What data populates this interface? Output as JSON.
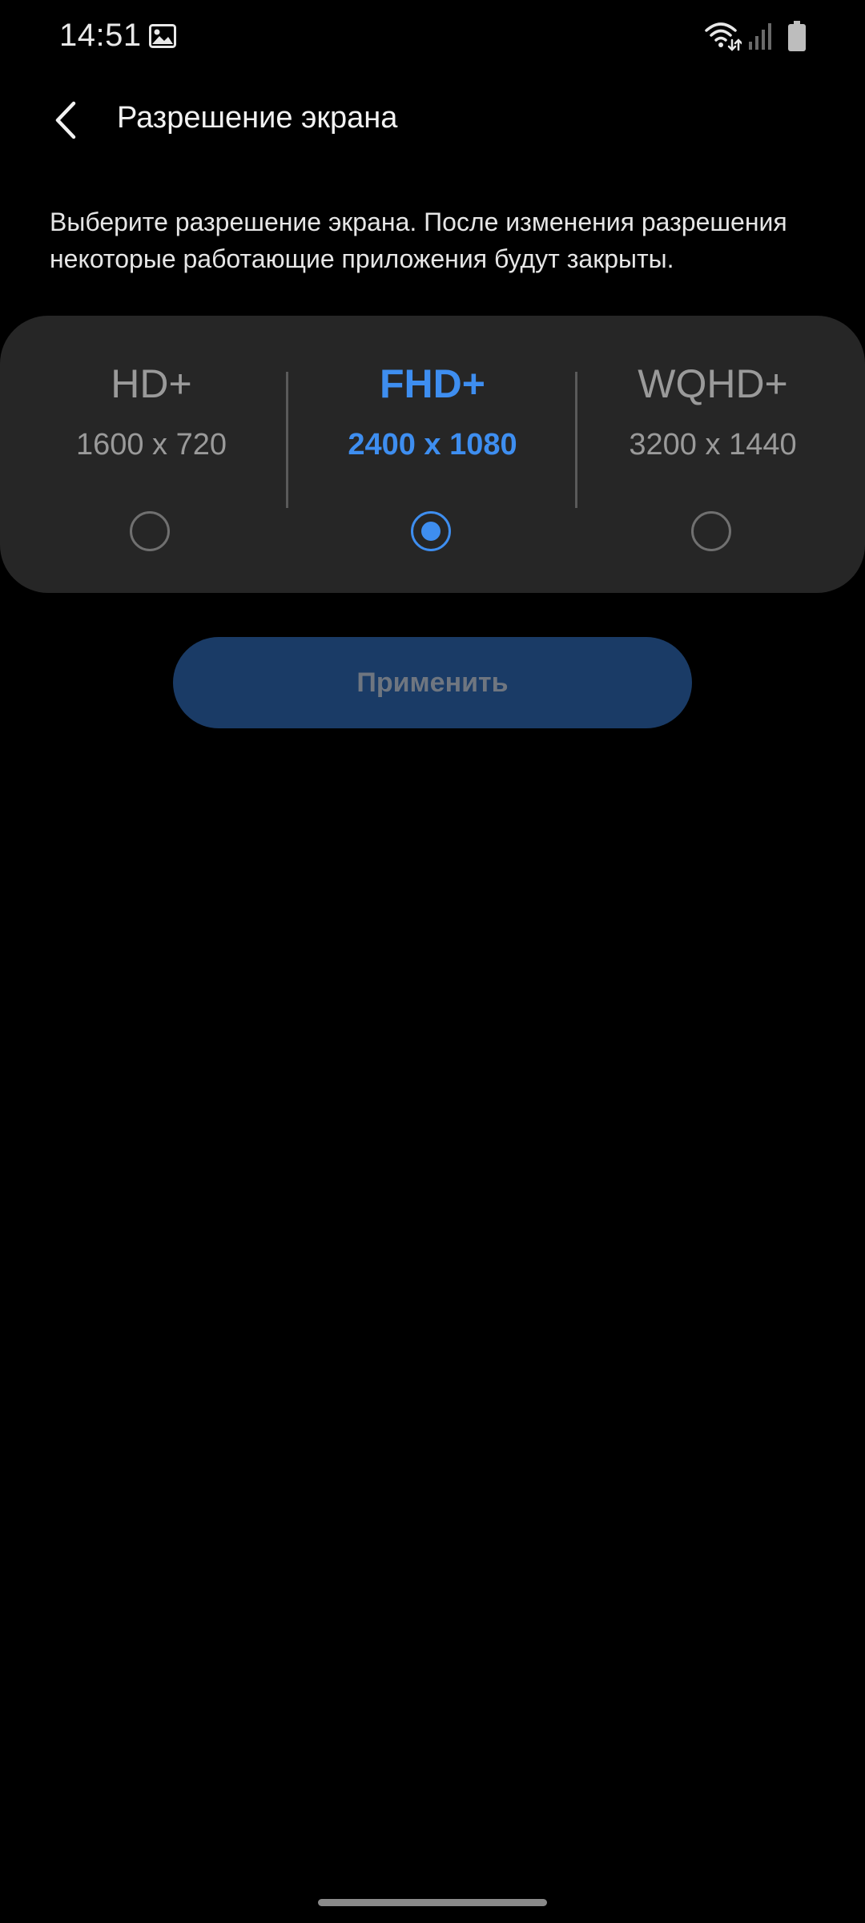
{
  "status_bar": {
    "time": "14:51",
    "icons": [
      "gallery-icon",
      "wifi-icon",
      "signal-icon",
      "battery-icon"
    ]
  },
  "header": {
    "back_icon": "chevron-left-icon",
    "title": "Разрешение экрана"
  },
  "description": "Выберите разрешение экрана. После изменения разрешения некоторые работающие приложения будут закрыты.",
  "resolutions": [
    {
      "name": "HD+",
      "size": "1600 x 720",
      "selected": false
    },
    {
      "name": "FHD+",
      "size": "2400 x 1080",
      "selected": true
    },
    {
      "name": "WQHD+",
      "size": "3200 x 1440",
      "selected": false
    }
  ],
  "apply_button": {
    "label": "Применить",
    "enabled": false
  },
  "colors": {
    "accent": "#3e8ef0",
    "card_background": "#262626",
    "apply_background": "#1a3b66",
    "apply_text": "#6f7680",
    "inactive_text": "#9a9a9a"
  }
}
